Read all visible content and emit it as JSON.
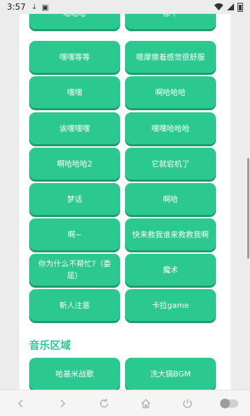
{
  "status_bar": {
    "time": "3:57"
  },
  "sound_buttons": [
    {
      "label": "嗯嗯嗯"
    },
    {
      "label": "那个"
    },
    {
      "label": "嘿嘿等等"
    },
    {
      "label": "嗯摩擦着感觉很舒服"
    },
    {
      "label": "嘿嘿"
    },
    {
      "label": "啊哈哈哈"
    },
    {
      "label": "诶嘿嘿嘿"
    },
    {
      "label": "嘿嘿哈哈哈"
    },
    {
      "label": "啊哈哈哈2"
    },
    {
      "label": "它就宕机了"
    },
    {
      "label": "梦话"
    },
    {
      "label": "啊哈"
    },
    {
      "label": "啊~"
    },
    {
      "label": "快来救我谁来救救我啊"
    },
    {
      "label": "你为什么不帮忙?（委屈）"
    },
    {
      "label": "魔术"
    },
    {
      "label": "新人注意"
    },
    {
      "label": "卡拉game"
    }
  ],
  "music_section": {
    "title": "音乐区域",
    "buttons": [
      {
        "label": "哈基米战歌"
      },
      {
        "label": "洗大锅BGM"
      }
    ]
  },
  "colors": {
    "accent": "#2bc88f",
    "accent_shadow": "#1f9c6e",
    "danger": "#ef6b63"
  }
}
